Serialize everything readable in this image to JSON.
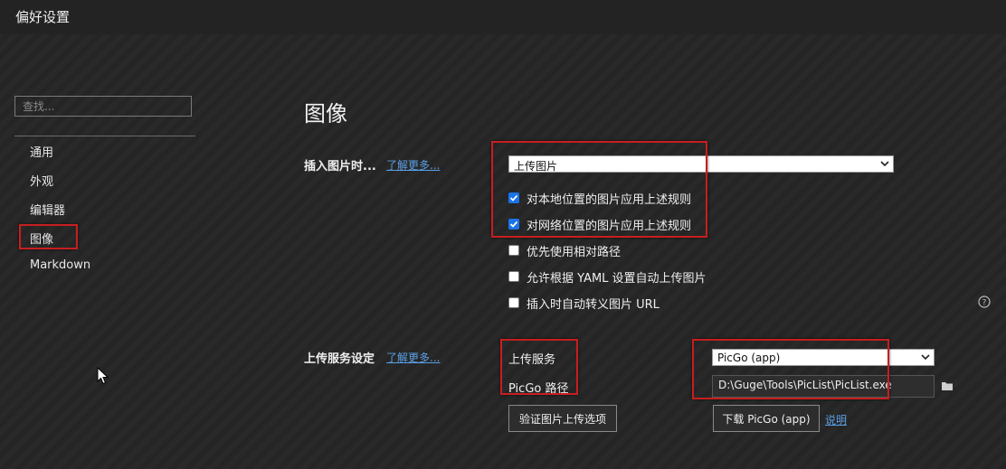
{
  "window": {
    "title": "偏好设置"
  },
  "sidebar": {
    "search_placeholder": "查找...",
    "items": [
      {
        "label": "通用"
      },
      {
        "label": "外观"
      },
      {
        "label": "编辑器"
      },
      {
        "label": "图像",
        "selected": true
      },
      {
        "label": "Markdown"
      }
    ]
  },
  "main": {
    "title": "图像",
    "insert_section": {
      "label": "插入图片时...",
      "learn_more": "了解更多...",
      "action_select": "上传图片",
      "options": [
        {
          "label": "对本地位置的图片应用上述规则",
          "checked": true
        },
        {
          "label": "对网络位置的图片应用上述规则",
          "checked": true
        },
        {
          "label": "优先使用相对路径",
          "checked": false
        },
        {
          "label": "允许根据 YAML 设置自动上传图片",
          "checked": false
        },
        {
          "label": "插入时自动转义图片 URL",
          "checked": false
        }
      ],
      "help_icon": "question-circle-icon"
    },
    "upload_section": {
      "label": "上传服务设定",
      "learn_more": "了解更多...",
      "service_label": "上传服务",
      "service_value": "PicGo (app)",
      "path_label": "PicGo 路径",
      "path_value": "D:\\Guge\\Tools\\PicList\\PicList.exe",
      "folder_icon": "folder-icon",
      "verify_button": "验证图片上传选项",
      "download_button": "下载 PicGo (app)",
      "explain_link": "说明"
    }
  },
  "colors": {
    "accent": "#1a73e8",
    "link": "#5aa0e6",
    "highlight_box": "#c81e1e"
  }
}
